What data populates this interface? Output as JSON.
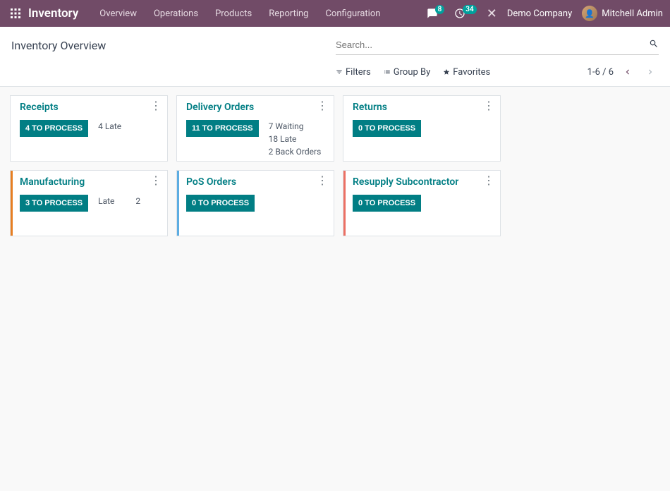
{
  "navbar": {
    "brand": "Inventory",
    "menu": [
      "Overview",
      "Operations",
      "Products",
      "Reporting",
      "Configuration"
    ],
    "messages_badge": "8",
    "activities_badge": "34",
    "company": "Demo Company",
    "user": "Mitchell Admin"
  },
  "control_panel": {
    "title": "Inventory Overview",
    "search_placeholder": "Search...",
    "filters": "Filters",
    "group_by": "Group By",
    "favorites": "Favorites",
    "pager": "1-6 / 6"
  },
  "cards": [
    {
      "title": "Receipts",
      "button": "4 TO PROCESS",
      "stripe": "none",
      "stats": [
        {
          "label": "4 Late"
        }
      ]
    },
    {
      "title": "Delivery Orders",
      "button": "11 TO PROCESS",
      "stripe": "none",
      "stats": [
        {
          "label": "7 Waiting"
        },
        {
          "label": "18 Late"
        },
        {
          "label": "2 Back Orders"
        }
      ]
    },
    {
      "title": "Returns",
      "button": "0 TO PROCESS",
      "stripe": "none",
      "stats": []
    },
    {
      "title": "Manufacturing",
      "button": "3 TO PROCESS",
      "stripe": "orange",
      "stats": [
        {
          "label": "Late",
          "value": "2"
        }
      ]
    },
    {
      "title": "PoS Orders",
      "button": "0 TO PROCESS",
      "stripe": "blue",
      "stats": []
    },
    {
      "title": "Resupply Subcontractor",
      "button": "0 TO PROCESS",
      "stripe": "red",
      "stats": []
    }
  ]
}
